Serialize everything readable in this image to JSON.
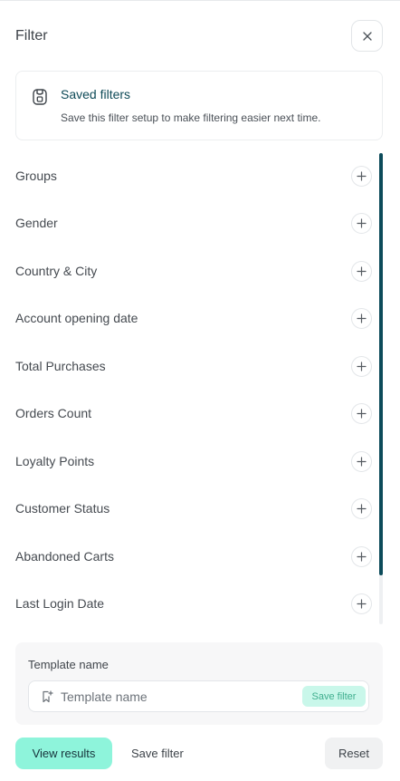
{
  "header": {
    "title": "Filter",
    "close_icon": "close-icon"
  },
  "saved_filters": {
    "icon": "saved-filter-icon",
    "title": "Saved filters",
    "description": "Save this filter setup to make filtering easier next time."
  },
  "filters": [
    {
      "label": "Groups"
    },
    {
      "label": "Gender"
    },
    {
      "label": "Country & City"
    },
    {
      "label": "Account opening date"
    },
    {
      "label": "Total Purchases"
    },
    {
      "label": "Orders Count"
    },
    {
      "label": "Loyalty Points"
    },
    {
      "label": "Customer Status"
    },
    {
      "label": "Abandoned Carts"
    },
    {
      "label": "Last Login Date"
    }
  ],
  "template": {
    "label": "Template name",
    "input_placeholder": "Template name",
    "input_value": "",
    "save_label": "Save filter"
  },
  "footer": {
    "view_results_label": "View results",
    "save_filter_label": "Save filter",
    "reset_label": "Reset"
  },
  "colors": {
    "accent": "#8ef4db",
    "accent_soft": "#c9f7ea",
    "brand_dark": "#0c4b5a",
    "scroll_thumb": "#0c4b5a"
  }
}
